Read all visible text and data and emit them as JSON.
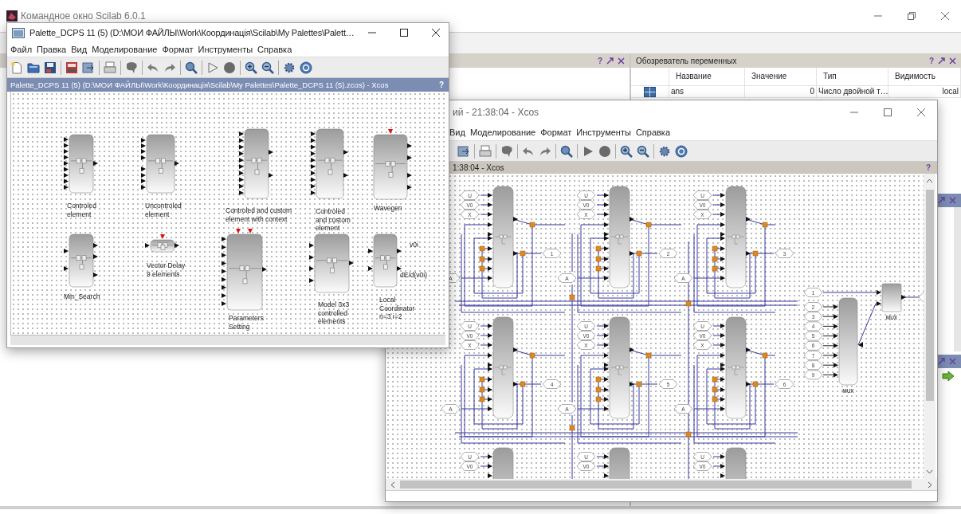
{
  "console_window": {
    "title": "Командное окно Scilab 6.0.1"
  },
  "left_dock": {
    "help": "?"
  },
  "variable_browser": {
    "title": "Обозреватель переменных",
    "help": "?",
    "columns": [
      "Название",
      "Значение",
      "Тип",
      "Видимость"
    ],
    "rows": [
      {
        "cells": [
          "ans",
          "0",
          "Число двойной т…",
          "local"
        ]
      }
    ]
  },
  "palette_window": {
    "title": "Palette_DCPS 11 (5) (D:\\МОИ ФАЙЛЫ\\Work\\Координація\\Scilab\\My Palettes\\Palett…",
    "menu": [
      "Файл",
      "Правка",
      "Вид",
      "Моделирование",
      "Формат",
      "Инструменты",
      "Справка"
    ],
    "header": "Palette_DCPS 11 (5) (D:\\МОИ ФАЙЛЫ\\Work\\Координація\\Scilab\\My Palettes\\Palette_DCPS 11 (5).zcos) - Xcos",
    "header_help": "?",
    "blocks": [
      {
        "label": "Controled\nelement"
      },
      {
        "label": "Uncontroled\nelement"
      },
      {
        "label": "Controled and custom\nelement with context"
      },
      {
        "label": "Controled\nand custom\nelement"
      },
      {
        "label": "Wavegen"
      },
      {
        "label": "Min_Search"
      },
      {
        "label": "Vector Delay\n9 elements"
      },
      {
        "label": "Parameters\nSetting"
      },
      {
        "label": "Model 3x3\ncontrolled\nelements"
      },
      {
        "label": "Local\nCoordinator\nn=3 i=2",
        "port_labels": [
          "v0i",
          "dE/d(v0i)"
        ]
      }
    ]
  },
  "xcos_window": {
    "title": "ий - 21:38:04 - Xcos",
    "menu": [
      "Вид",
      "Моделирование",
      "Формат",
      "Инструменты",
      "Справка"
    ],
    "header": "1:38:04 - Xcos",
    "header_help": "?",
    "modules": [
      {
        "inputs": [
          "U",
          "V0",
          "X"
        ],
        "enable": "A",
        "output": "1"
      },
      {
        "inputs": [
          "U",
          "V0",
          "X"
        ],
        "enable": "A",
        "output": "2"
      },
      {
        "inputs": [
          "U",
          "V0",
          "X"
        ],
        "enable": "A",
        "output": "3"
      },
      {
        "inputs": [
          "U",
          "V0",
          "X"
        ],
        "enable": "A",
        "output": "4"
      },
      {
        "inputs": [
          "U",
          "V0",
          "X"
        ],
        "enable": "A",
        "output": "5"
      },
      {
        "inputs": [
          "U",
          "V0",
          "X"
        ],
        "enable": "A",
        "output": "6"
      },
      {
        "inputs": [
          "U",
          "V0"
        ]
      },
      {
        "inputs": [
          "U",
          "V0"
        ]
      },
      {
        "inputs": [
          "U",
          "V0"
        ]
      }
    ],
    "mux": {
      "inputs": [
        "1",
        "2",
        "3",
        "4",
        "5",
        "6",
        "7",
        "8",
        "9"
      ],
      "labels": [
        "MUX",
        "MUX"
      ]
    }
  }
}
